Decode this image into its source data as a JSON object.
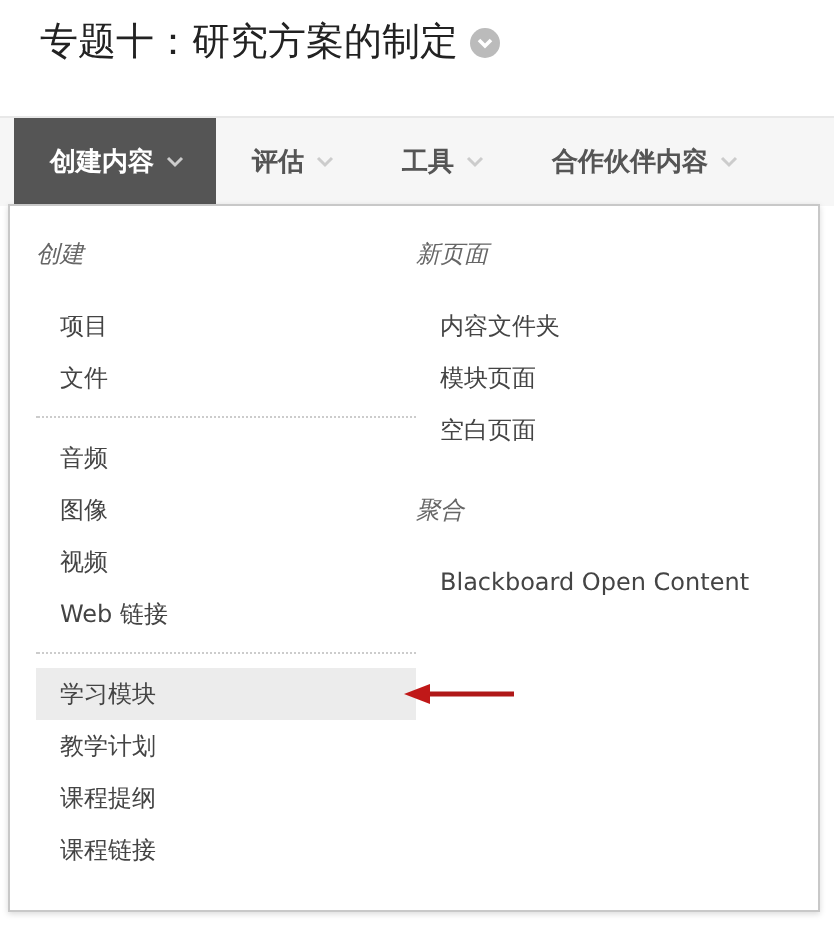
{
  "page_title": "专题十：研究方案的制定",
  "tabs": [
    {
      "label": "创建内容",
      "selected": true
    },
    {
      "label": "评估",
      "selected": false
    },
    {
      "label": "工具",
      "selected": false
    },
    {
      "label": "合作伙伴内容",
      "selected": false
    }
  ],
  "menu": {
    "columns": [
      {
        "sections": [
          {
            "heading": "创建",
            "groups": [
              [
                {
                  "label": "项目",
                  "selected": false
                },
                {
                  "label": "文件",
                  "selected": false
                }
              ],
              [
                {
                  "label": "音频",
                  "selected": false
                },
                {
                  "label": "图像",
                  "selected": false
                },
                {
                  "label": "视频",
                  "selected": false
                },
                {
                  "label": "Web 链接",
                  "selected": false
                }
              ],
              [
                {
                  "label": "学习模块",
                  "selected": true
                },
                {
                  "label": "教学计划",
                  "selected": false
                },
                {
                  "label": "课程提纲",
                  "selected": false
                },
                {
                  "label": "课程链接",
                  "selected": false
                }
              ]
            ]
          }
        ]
      },
      {
        "sections": [
          {
            "heading": "新页面",
            "groups": [
              [
                {
                  "label": "内容文件夹",
                  "selected": false
                },
                {
                  "label": "模块页面",
                  "selected": false
                },
                {
                  "label": "空白页面",
                  "selected": false
                }
              ]
            ]
          },
          {
            "heading": "聚合",
            "groups": [
              [
                {
                  "label": "Blackboard Open Content",
                  "selected": false
                }
              ]
            ]
          }
        ]
      }
    ]
  }
}
